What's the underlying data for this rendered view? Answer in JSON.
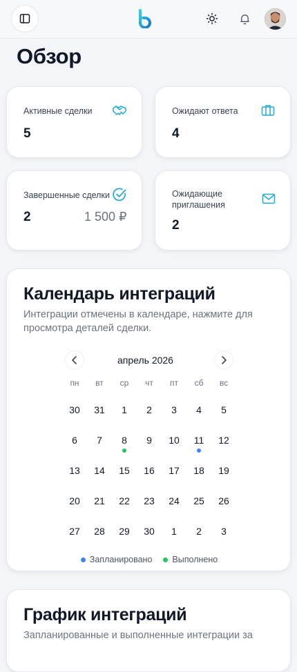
{
  "header": {
    "logo_letter": "b",
    "colors": {
      "accent": "#1ea7d4",
      "plan": "#3b82f6",
      "done": "#22c55e"
    }
  },
  "page": {
    "title": "Обзор"
  },
  "stats": [
    {
      "label": "Активные сделки",
      "value": "5",
      "icon": "handshake-icon"
    },
    {
      "label": "Ожидают ответа",
      "value": "4",
      "icon": "briefcase-icon"
    },
    {
      "label": "Завершенные сделки",
      "value": "2",
      "sub": "1 500 ₽",
      "icon": "check-circle-icon"
    },
    {
      "label": "Ожидающие приглашения",
      "value": "2",
      "icon": "mail-icon"
    }
  ],
  "calendar": {
    "title": "Календарь интеграций",
    "description": "Интеграции отмечены в календаре, нажмите для просмотра деталей сделки.",
    "month": "апрель 2026",
    "weekdays": [
      "пн",
      "вт",
      "ср",
      "чт",
      "пт",
      "сб",
      "вс"
    ],
    "weeks": [
      [
        "30",
        "31",
        "1",
        "2",
        "3",
        "4",
        "5"
      ],
      [
        "6",
        "7",
        "8",
        "9",
        "10",
        "11",
        "12"
      ],
      [
        "13",
        "14",
        "15",
        "16",
        "17",
        "18",
        "19"
      ],
      [
        "20",
        "21",
        "22",
        "23",
        "24",
        "25",
        "26"
      ],
      [
        "27",
        "28",
        "29",
        "30",
        "1",
        "2",
        "3"
      ]
    ],
    "markers": [
      {
        "week": 1,
        "day": 2,
        "status": "done"
      },
      {
        "week": 1,
        "day": 5,
        "status": "plan"
      }
    ],
    "legend": {
      "planned": "Запланировано",
      "done": "Выполнено"
    }
  },
  "chart_section": {
    "title": "График интеграций",
    "description": "Запланированные и выполненные интеграции за"
  }
}
